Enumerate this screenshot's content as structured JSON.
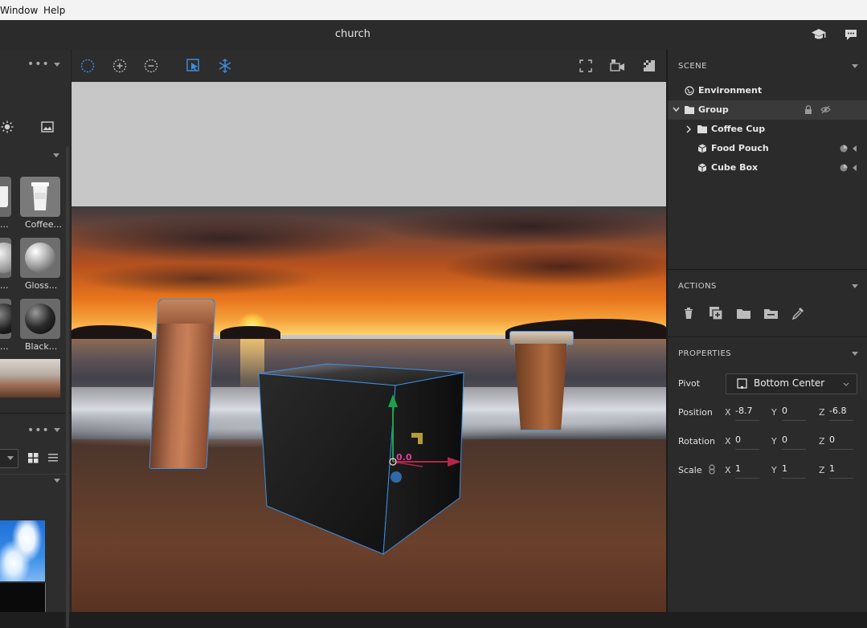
{
  "menubar": {
    "items": [
      "Window",
      "Help"
    ]
  },
  "app": {
    "title": "church"
  },
  "left_panel": {
    "materials": [
      "Coffee...",
      "Gloss...",
      "Black..."
    ],
    "partial_labels": [
      "...",
      "...",
      "..."
    ]
  },
  "scene": {
    "title": "SCENE",
    "items": [
      {
        "label": "Environment"
      },
      {
        "label": "Group"
      },
      {
        "label": "Coffee Cup"
      },
      {
        "label": "Food Pouch"
      },
      {
        "label": "Cube Box"
      }
    ]
  },
  "actions": {
    "title": "ACTIONS"
  },
  "properties": {
    "title": "PROPERTIES",
    "pivot_label": "Pivot",
    "pivot_value": "Bottom Center",
    "position_label": "Position",
    "rotation_label": "Rotation",
    "scale_label": "Scale",
    "axis_x": "X",
    "axis_y": "Y",
    "axis_z": "Z",
    "position": {
      "x": "-8.7",
      "y": "0",
      "z": "-6.8"
    },
    "rotation": {
      "x": "0",
      "y": "0",
      "z": "0"
    },
    "scale": {
      "x": "1",
      "y": "1",
      "z": "1"
    }
  },
  "viewport": {
    "gizmo_value": "0.0"
  },
  "colors": {
    "accent": "#3e8fe0",
    "panel": "#2b2b2b",
    "selected_row": "#3a3a3a"
  }
}
